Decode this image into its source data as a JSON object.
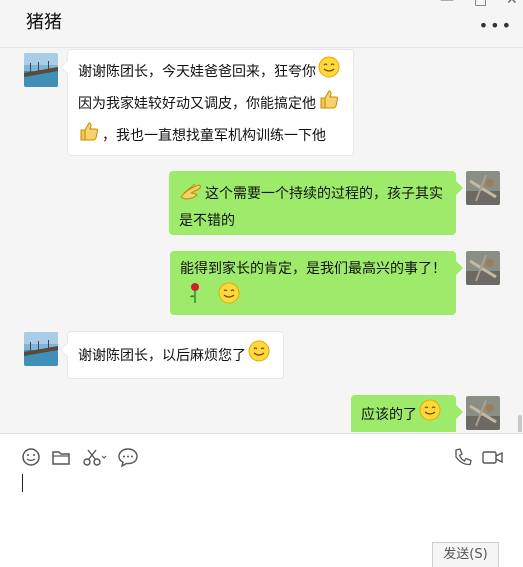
{
  "header": {
    "title": "猪猪",
    "more_label": "•••"
  },
  "messages": [
    {
      "side": "left",
      "lines": [
        "谢谢陈团长，今天娃爸爸回来，狂夸你",
        "因为我家娃较好动又调皮，你能搞定他",
        "，我也一直想找童军机构训练一下他"
      ]
    },
    {
      "side": "right",
      "lines": [
        "这个需要一个持续的过程的，孩子其实",
        "是不错的"
      ]
    },
    {
      "side": "right",
      "lines": [
        "能得到家长的肯定，是我们最高兴的事了！"
      ]
    },
    {
      "side": "left",
      "lines": [
        "谢谢陈团长，以后麻烦您了"
      ]
    },
    {
      "side": "right",
      "lines": [
        "应该的了"
      ]
    }
  ],
  "composer": {
    "send_label": "发送(S)"
  },
  "colors": {
    "right_bubble": "#9eea6a",
    "left_bubble": "#ffffff",
    "background": "#f5f5f5"
  }
}
